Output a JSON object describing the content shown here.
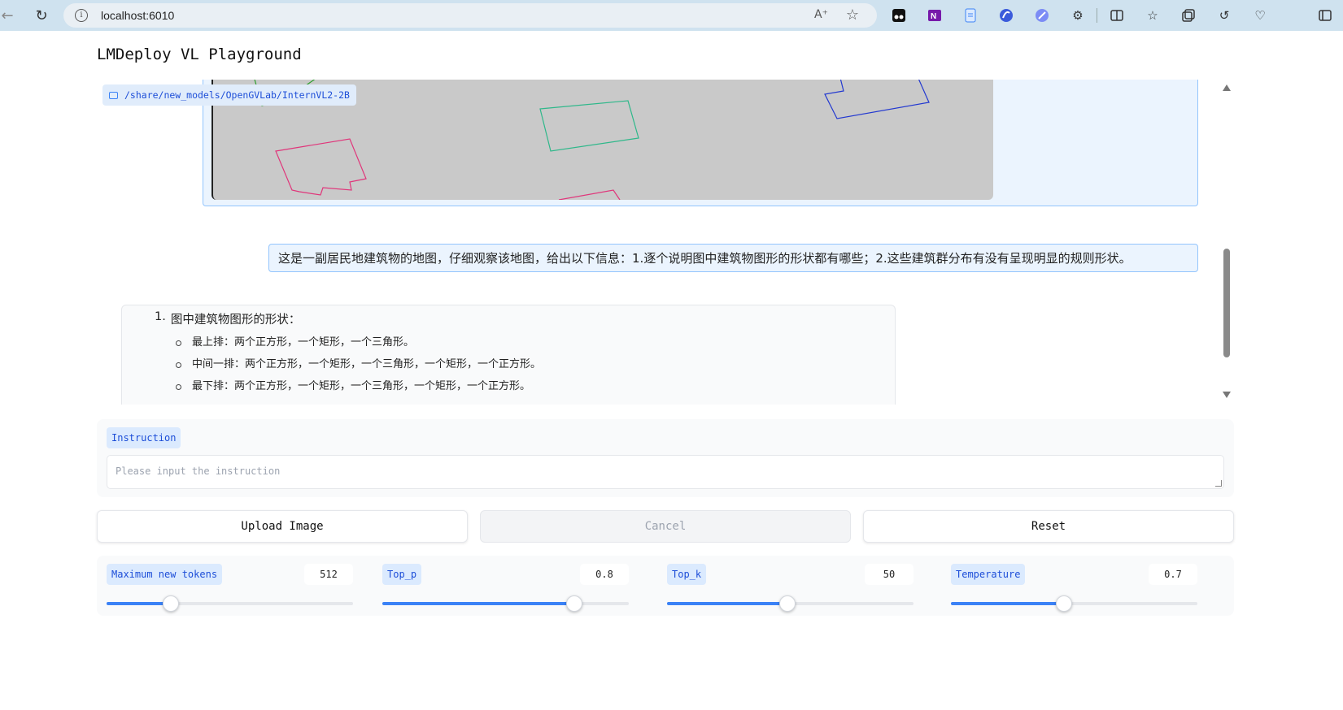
{
  "browser": {
    "url": "localhost:6010",
    "extensions": [
      "tampermonkey-icon",
      "onenote-icon",
      "document-icon",
      "copilot-icon",
      "pen-icon",
      "extensions-puzzle-icon",
      "split-screen-icon",
      "favorites-icon",
      "collections-icon",
      "history-icon",
      "performance-icon",
      "sidebar-icon"
    ]
  },
  "page": {
    "title": "LMDeploy VL Playground"
  },
  "chatbot": {
    "model_path": "/share/new_models/OpenGVLab/InternVL2-2B",
    "user_message": "这是一副居民地建筑物的地图，仔细观察该地图，给出以下信息：1.逐个说明图中建筑物图形的形状都有哪些；2.这些建筑群分布有没有呈现明显的规则形状。",
    "bot_reply": {
      "item_number": "1.",
      "item_title": "图中建筑物图形的形状：",
      "bullets": [
        "最上排：两个正方形，一个矩形，一个三角形。",
        "中间一排：两个正方形，一个矩形，一个三角形，一个矩形，一个正方形。",
        "最下排：两个正方形，一个矩形，一个三角形，一个矩形，一个正方形。"
      ]
    }
  },
  "instruction": {
    "label": "Instruction",
    "placeholder": "Please input the instruction"
  },
  "buttons": {
    "upload": "Upload Image",
    "cancel": "Cancel",
    "reset": "Reset"
  },
  "sliders": [
    {
      "label": "Maximum new tokens",
      "value": "512",
      "fraction": 0.26
    },
    {
      "label": "Top_p",
      "value": "0.8",
      "fraction": 0.78
    },
    {
      "label": "Top_k",
      "value": "50",
      "fraction": 0.49
    },
    {
      "label": "Temperature",
      "value": "0.7",
      "fraction": 0.46
    }
  ],
  "colors": {
    "accent": "#3b82f6",
    "chip_bg": "#dbeafe",
    "bubble_bg": "#ebf4fe"
  }
}
